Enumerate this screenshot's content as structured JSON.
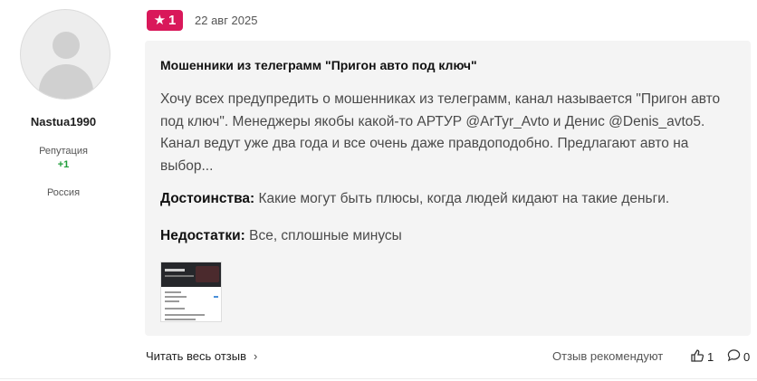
{
  "author": {
    "name": "Nastua1990",
    "reputation_label": "Репутация",
    "reputation_value": "+1",
    "country": "Россия"
  },
  "review": {
    "rating": "1",
    "date": "22 авг 2025",
    "title": "Мошенники из телеграмм \"Пригон авто под ключ\"",
    "text": "Хочу всех предупредить о мошенниках из телеграмм, канал называется \"Пригон авто под ключ\". Менеджеры якобы какой-то АРТУР @ArTyr_Avto и Денис @Denis_avto5. Канал ведут уже два года и все очень даже правдоподобно. Предлагают авто на выбор...",
    "pros_label": "Достоинства:",
    "pros_text": "Какие могут быть плюсы, когда людей кидают на такие деньги.",
    "cons_label": "Недостатки:",
    "cons_text": "Все, сплошные минусы"
  },
  "footer": {
    "read_all": "Читать весь отзыв",
    "recommend": "Отзыв рекомендуют",
    "likes": "1",
    "comments": "0"
  },
  "colors": {
    "rating_badge": "#d9185a",
    "reputation_positive": "#1f9d3a",
    "card_bg": "#f4f4f4"
  },
  "icons": {
    "rating": "star-icon",
    "read_all": "chevron-right-icon",
    "likes": "thumbs-up-icon",
    "comments": "speech-bubble-icon"
  }
}
